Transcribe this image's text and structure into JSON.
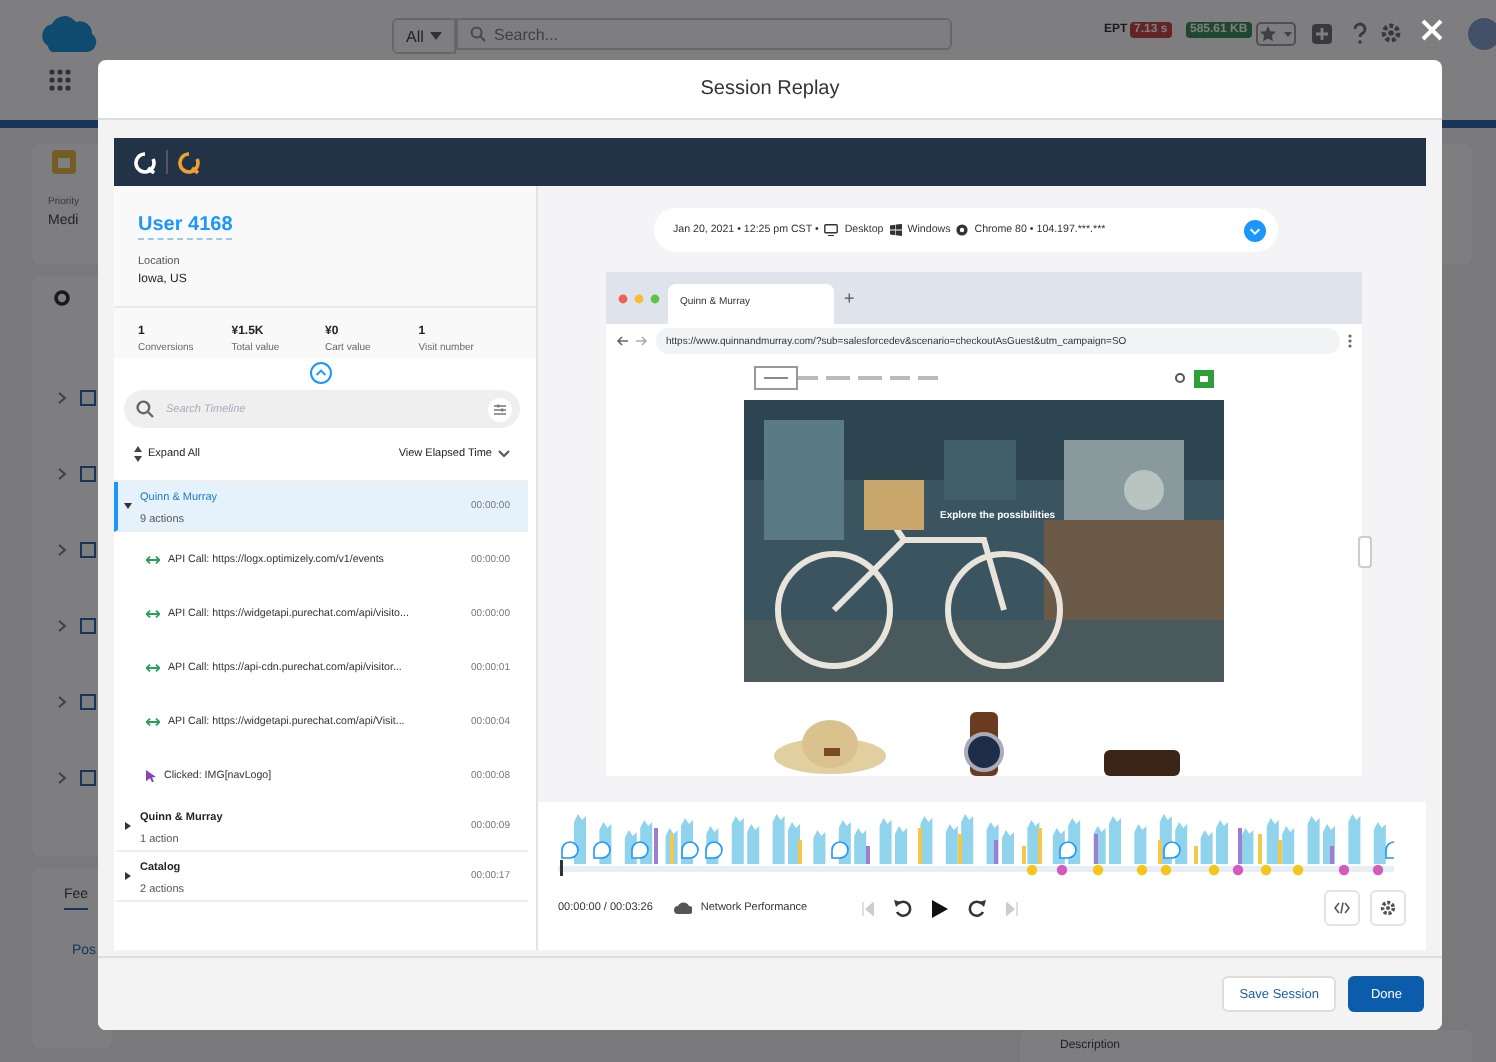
{
  "top_bar": {
    "scope": "All",
    "search": {
      "placeholder": "Search..."
    },
    "ept_label": "EPT",
    "ept_time": "7.13 s",
    "ept_size": "585.61 KB"
  },
  "background": {
    "priority_label": "Priority",
    "priority_value": "Medi",
    "feed_tab": "Fee",
    "post_tab": "Pos",
    "description_label": "Description"
  },
  "modal": {
    "title": "Session Replay"
  },
  "visitor": {
    "name": "User 4168",
    "location_label": "Location",
    "location": "Iowa, US"
  },
  "stats": [
    {
      "value": "1",
      "label": "Conversions"
    },
    {
      "value": "¥1.5K",
      "label": "Total value"
    },
    {
      "value": "¥0",
      "label": "Cart value"
    },
    {
      "value": "1",
      "label": "Visit number"
    }
  ],
  "timeline_search": {
    "placeholder": "Search Timeline"
  },
  "expand_all": "Expand All",
  "view_mode": "View Elapsed Time",
  "pages": [
    {
      "title": "Quinn & Murray",
      "count": "9 actions",
      "time": "00:00:00",
      "expanded": true,
      "selected": true,
      "children": [
        {
          "kind": "api",
          "text": "API Call: https://logx.optimizely.com/v1/events",
          "time": "00:00:00"
        },
        {
          "kind": "api",
          "text": "API Call: https://widgetapi.purechat.com/api/visito...",
          "time": "00:00:00"
        },
        {
          "kind": "api",
          "text": "API Call: https://api-cdn.purechat.com/api/visitor...",
          "time": "00:00:01"
        },
        {
          "kind": "api",
          "text": "API Call: https://widgetapi.purechat.com/api/Visit...",
          "time": "00:00:04"
        },
        {
          "kind": "click",
          "text": "Clicked: IMG[navLogo]",
          "time": "00:00:08"
        }
      ]
    },
    {
      "title": "Quinn & Murray",
      "count": "1 action",
      "time": "00:00:09",
      "expanded": false,
      "selected": false
    },
    {
      "title": "Catalog",
      "count": "2 actions",
      "time": "00:00:17",
      "expanded": false,
      "selected": false
    }
  ],
  "session_info": {
    "date": "Jan 20, 2021 • 12:25 pm CST •",
    "device": "Desktop",
    "os": "Windows",
    "browser": "Chrome 80 • 104.197.***.***"
  },
  "browser": {
    "tab": "Quinn & Murray",
    "new_tab": "+",
    "url": "https://www.quinnandmurray.com/?sub=salesforcedev&scenario=checkoutAsGuest&utm_campaign=SO"
  },
  "hero_text": "Explore the possibilities",
  "player": {
    "time": "00:00:00 / 00:03:26",
    "network": "Network Performance"
  },
  "buttons": [
    {
      "label": "Save Session",
      "kind": "secondary"
    },
    {
      "label": "Done",
      "kind": "primary"
    }
  ]
}
